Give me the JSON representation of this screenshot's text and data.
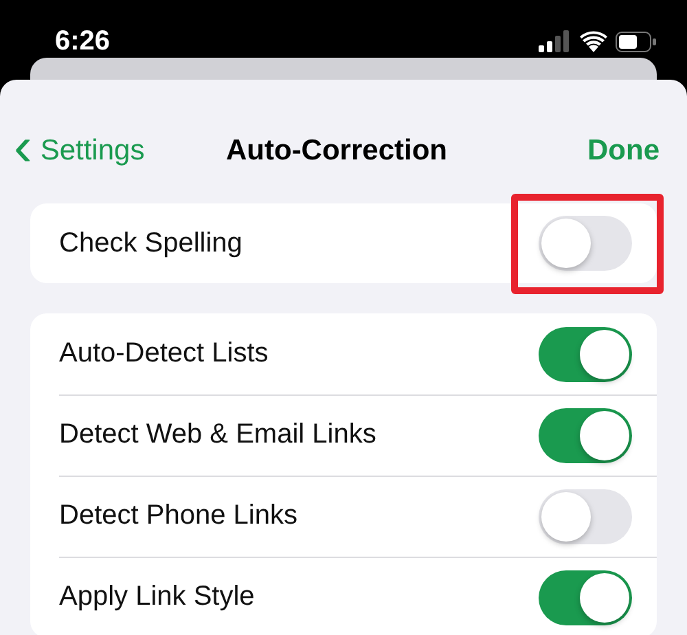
{
  "status_bar": {
    "time": "6:26"
  },
  "nav": {
    "back": "Settings",
    "back_icon": "‹",
    "title": "Auto-Correction",
    "done": "Done"
  },
  "groups": [
    {
      "rows": [
        {
          "label": "Check Spelling",
          "on": false,
          "highlighted": true
        }
      ]
    },
    {
      "rows": [
        {
          "label": "Auto-Detect Lists",
          "on": true,
          "highlighted": false
        },
        {
          "label": "Detect Web & Email Links",
          "on": true,
          "highlighted": false
        },
        {
          "label": "Detect Phone Links",
          "on": false,
          "highlighted": false
        },
        {
          "label": "Apply Link Style",
          "on": true,
          "highlighted": false
        }
      ]
    }
  ]
}
